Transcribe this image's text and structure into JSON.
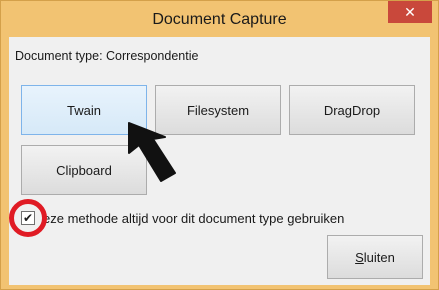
{
  "window": {
    "title": "Document Capture",
    "close_label": "✕"
  },
  "document_type": {
    "label": "Document type: Correspondentie"
  },
  "buttons": {
    "twain": "Twain",
    "filesystem": "Filesystem",
    "dragdrop": "DragDrop",
    "clipboard": "Clipboard",
    "sluiten_underlined": "S",
    "sluiten_rest": "luiten"
  },
  "checkbox": {
    "checked": true,
    "label": "eze methode altijd voor dit document type gebruiken",
    "mark": "✔"
  },
  "colors": {
    "title_bar": "#f2c372",
    "close_button": "#c9483b",
    "highlight_circle": "#e01b24",
    "hover_button": "#d6e9f8"
  },
  "icons": {
    "close": "close-icon",
    "pointer": "arrow-pointer-icon",
    "check": "checkmark-icon"
  }
}
